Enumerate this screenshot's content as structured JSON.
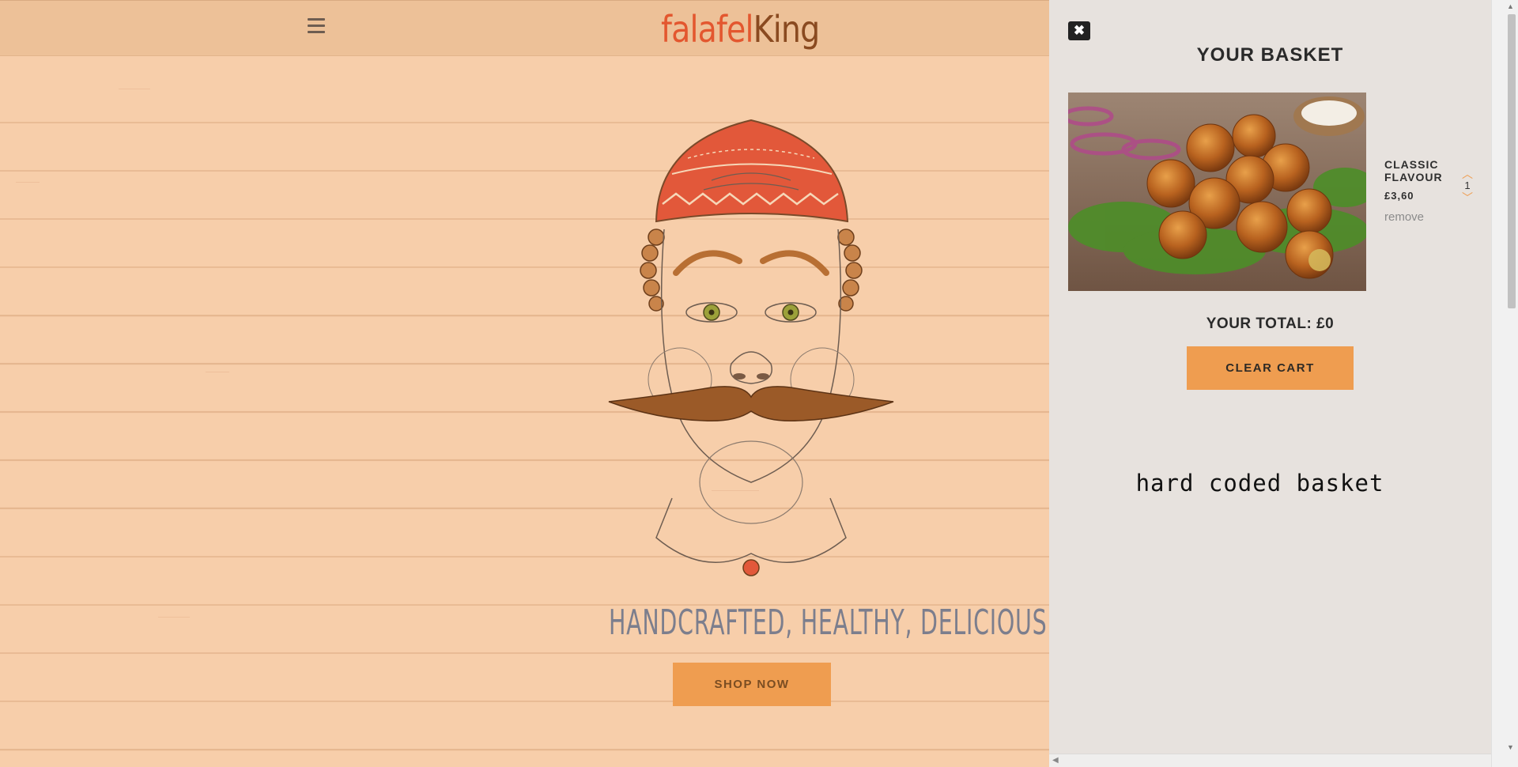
{
  "header": {
    "menu_icon": "hamburger-menu-icon",
    "logo_part1": "falafel",
    "logo_part2": "King"
  },
  "hero": {
    "tagline": "HANDCRAFTED, HEALTHY, DELICIOUS",
    "shop_button": "SHOP NOW"
  },
  "basket": {
    "close_icon": "close-icon",
    "title": "YOUR BASKET",
    "items": [
      {
        "name": "CLASSIC FLAVOUR",
        "price": "£3,60",
        "remove_label": "remove",
        "quantity": "1"
      }
    ],
    "total_label": "YOUR TOTAL: £0",
    "clear_button": "CLEAR CART",
    "note": "hard coded basket"
  },
  "colors": {
    "accent": "#ef9d50",
    "background": "#f7ceaa",
    "navbar": "#edc198",
    "panel": "#e7e2de",
    "logo_primary": "#e3572f",
    "logo_secondary": "#8a4a20"
  }
}
